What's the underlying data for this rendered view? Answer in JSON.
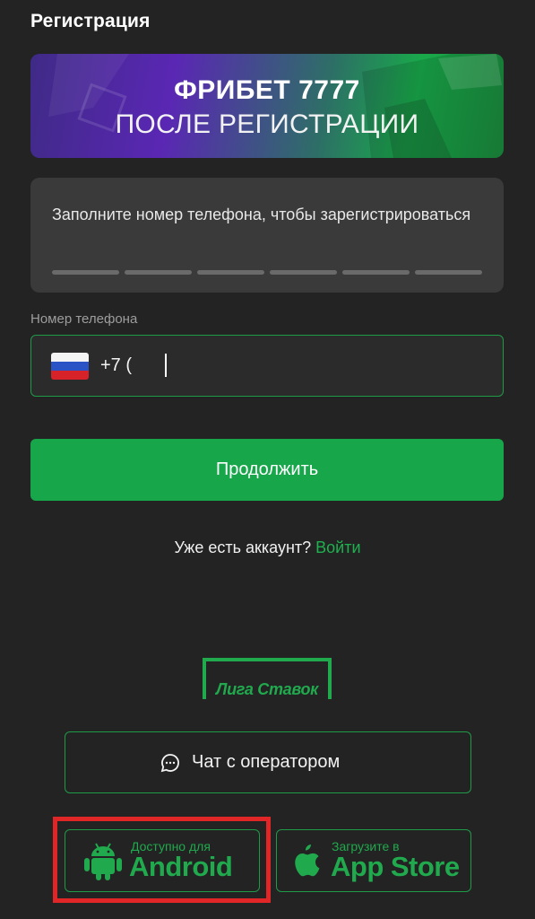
{
  "header": {
    "title": "Регистрация"
  },
  "banner": {
    "line1": "ФРИБЕТ 7777",
    "line2": "ПОСЛЕ РЕГИСТРАЦИИ"
  },
  "info": {
    "text": "Заполните номер телефона, чтобы зарегистрироваться",
    "progress_segments": 6,
    "progress_filled": 0
  },
  "phone": {
    "label": "Номер телефона",
    "prefix": "+7 (",
    "value": "",
    "country": "RU",
    "flag_icon": "russia-flag-icon"
  },
  "cta": {
    "label": "Продолжить"
  },
  "login": {
    "question": "Уже есть аккаунт?",
    "link": "Войти"
  },
  "logo": {
    "text": "Лига Ставок"
  },
  "chat": {
    "label": "Чат с оператором",
    "icon": "chat-bubble-icon"
  },
  "stores": {
    "android": {
      "small": "Доступно для",
      "big": "Android",
      "icon": "android-icon"
    },
    "ios": {
      "small": "Загрузите в",
      "big": "App Store",
      "icon": "apple-icon"
    }
  },
  "colors": {
    "accent": "#17a74a",
    "background": "#232323",
    "highlight": "#e02626"
  }
}
